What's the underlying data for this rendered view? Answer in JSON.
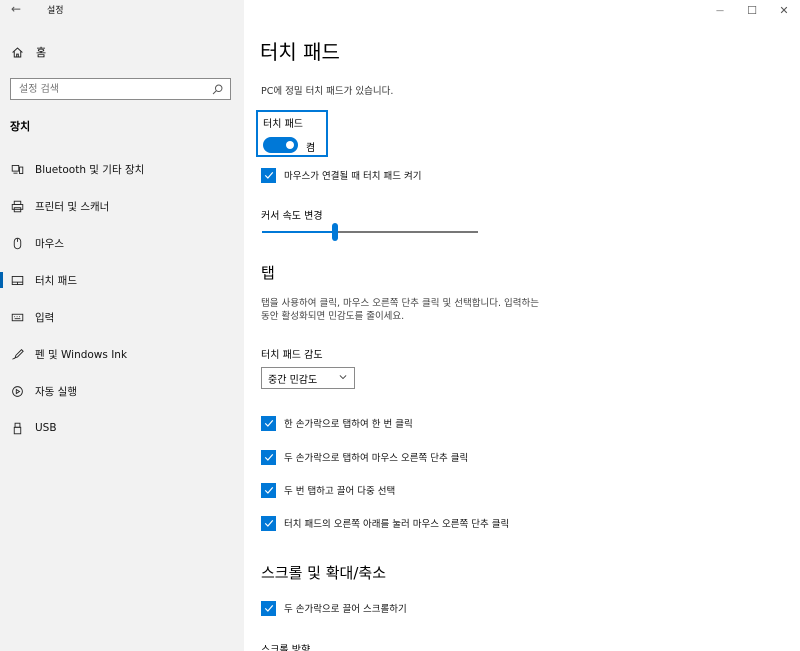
{
  "titlebar": {
    "back_glyph": "←",
    "app_title": "설정",
    "minimize_glyph": "—",
    "maximize_glyph": "☐",
    "close_glyph": "✕"
  },
  "sidebar": {
    "home_label": "홈",
    "search_placeholder": "설정 검색",
    "section_label": "장치",
    "items": [
      {
        "label": "Bluetooth 및 기타 장치",
        "icon": "bluetooth-devices-icon"
      },
      {
        "label": "프린터 및 스캐너",
        "icon": "printer-icon"
      },
      {
        "label": "마우스",
        "icon": "mouse-icon"
      },
      {
        "label": "터치 패드",
        "icon": "touchpad-icon",
        "active": true
      },
      {
        "label": "입력",
        "icon": "keyboard-icon"
      },
      {
        "label": "펜 및 Windows Ink",
        "icon": "pen-icon"
      },
      {
        "label": "자동 실행",
        "icon": "autoplay-icon"
      },
      {
        "label": "USB",
        "icon": "usb-icon"
      }
    ]
  },
  "main": {
    "title": "터치 패드",
    "subtitle": "PC에 정밀 터치 패드가 있습니다.",
    "touchpad_toggle": {
      "label": "터치 패드",
      "state": "켬",
      "on": true
    },
    "leave_on_with_mouse": {
      "label": "마우스가 연결될 때 터치 패드 켜기",
      "checked": true
    },
    "cursor_speed": {
      "label": "커서 속도 변경",
      "value": 0.34
    },
    "taps": {
      "heading": "탭",
      "description_line1": "탭을 사용하여 클릭, 마우스 오른쪽 단추 클릭 및 선택합니다. 입력하는",
      "description_line2": "동안 활성화되면 민감도를 줄이세요.",
      "sensitivity_label": "터치 패드 감도",
      "sensitivity_value": "중간 민감도",
      "options": [
        {
          "label": "한 손가락으로 탭하여 한 번 클릭",
          "checked": true
        },
        {
          "label": "두 손가락으로 탭하여 마우스 오른쪽 단추 클릭",
          "checked": true
        },
        {
          "label": "두 번 탭하고 끌어 다중 선택",
          "checked": true
        },
        {
          "label": "터치 패드의 오른쪽 아래를 눌러 마우스 오른쪽 단추 클릭",
          "checked": true
        }
      ]
    },
    "scroll_zoom": {
      "heading": "스크롤 및 확대/축소",
      "drag_two_fingers": {
        "label": "두 손가락으로 끌어 스크롤하기",
        "checked": true
      },
      "scroll_direction_label": "스크롤 방향"
    }
  },
  "colors": {
    "accent": "#0078d7",
    "sidebar_bg": "#f2f2f2"
  }
}
